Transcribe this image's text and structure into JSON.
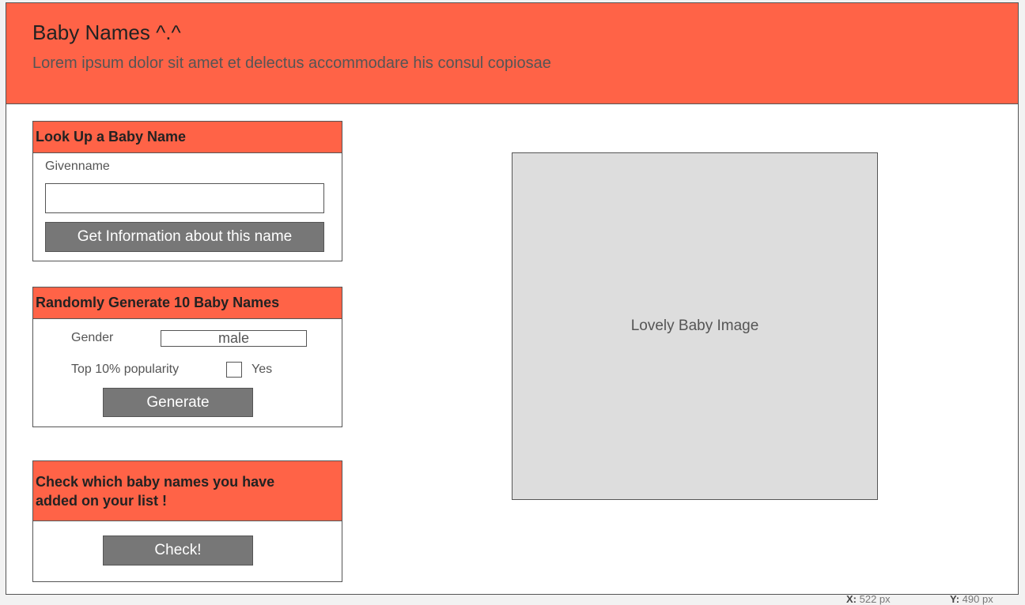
{
  "header": {
    "title": "Baby Names ^.^",
    "subtitle": "Lorem ipsum dolor sit amet et delectus accommodare his consul copiosae"
  },
  "lookup": {
    "heading": "Look Up a Baby Name",
    "field_label": "Givenname",
    "field_value": "",
    "button_label": "Get Information about this name"
  },
  "random": {
    "heading": "Randomly Generate 10 Baby Names",
    "gender_label": "Gender",
    "gender_value": "male",
    "popularity_label": "Top 10% popularity",
    "yes_label": "Yes",
    "button_label": "Generate"
  },
  "check": {
    "heading": "Check which baby names you have added on your list !",
    "button_label": "Check!"
  },
  "image": {
    "label": "Lovely Baby Image"
  },
  "status": {
    "x_label": "X:",
    "x_value": "522 px",
    "y_label": "Y:",
    "y_value": "490 px"
  },
  "colors": {
    "accent": "#ff6347",
    "button": "#777777",
    "placeholder": "#dddddd"
  }
}
